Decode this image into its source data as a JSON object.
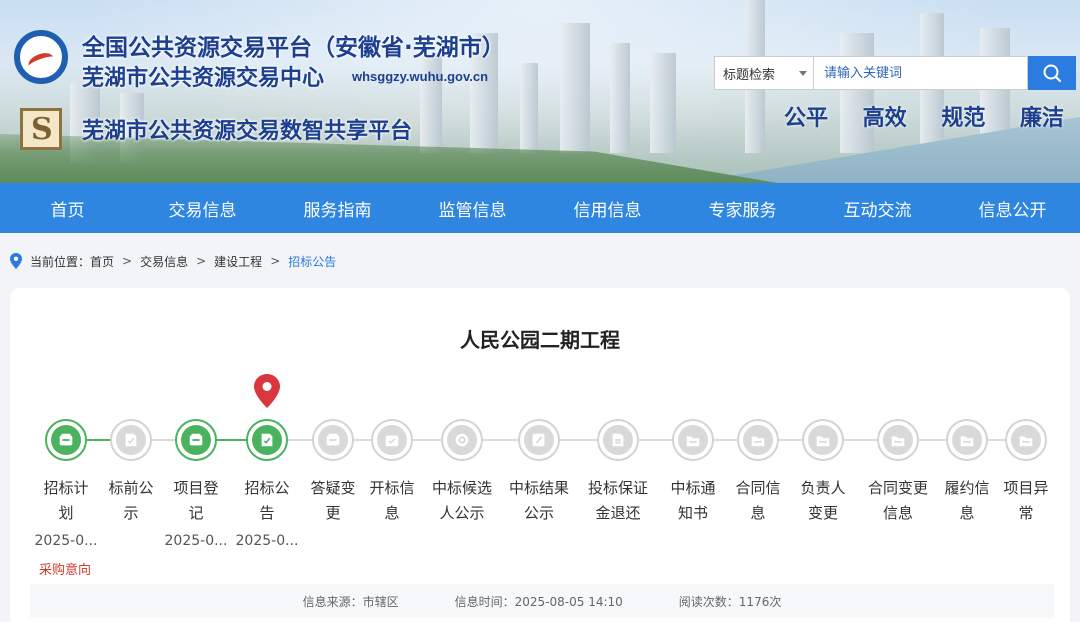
{
  "header": {
    "title_line1": "全国公共资源交易平台（安徽省·芜湖市）",
    "title_line2": "芜湖市公共资源交易中心",
    "domain": "whsggzy.wuhu.gov.cn",
    "title_line3": "芜湖市公共资源交易数智共享平台",
    "search": {
      "select_value": "标题检索",
      "placeholder": "请输入关键词"
    },
    "slogans": [
      "公平",
      "高效",
      "规范",
      "廉洁"
    ]
  },
  "nav": {
    "items": [
      "首页",
      "交易信息",
      "服务指南",
      "监管信息",
      "信用信息",
      "专家服务",
      "互动交流",
      "信息公开"
    ]
  },
  "breadcrumb": {
    "prefix": "当前位置：",
    "items": [
      "首页",
      "交易信息",
      "建设工程"
    ],
    "current": "招标公告",
    "separator": ">"
  },
  "main": {
    "title": "人民公园二期工程",
    "steps": [
      {
        "line1": "招标计",
        "line2": "划",
        "date": "2025-0...",
        "note": "采购意向",
        "status": "done",
        "icon": "box-icon"
      },
      {
        "line1": "标前公",
        "line2": "示",
        "date": "",
        "note": "",
        "status": "pending",
        "icon": "document-icon"
      },
      {
        "line1": "项目登",
        "line2": "记",
        "date": "2025-0...",
        "note": "",
        "status": "done",
        "icon": "box-icon"
      },
      {
        "line1": "招标公",
        "line2": "告",
        "date": "2025-0...",
        "note": "",
        "status": "done",
        "icon": "document-icon",
        "current": true
      },
      {
        "line1": "答疑变",
        "line2": "更",
        "date": "",
        "note": "",
        "status": "pending",
        "icon": "box-icon"
      },
      {
        "line1": "开标信",
        "line2": "息",
        "date": "",
        "note": "",
        "status": "pending",
        "icon": "calendar-icon"
      },
      {
        "line1": "中标候选",
        "line2": "人公示",
        "date": "",
        "note": "",
        "status": "pending",
        "icon": "target-icon"
      },
      {
        "line1": "中标结果",
        "line2": "公示",
        "date": "",
        "note": "",
        "status": "pending",
        "icon": "edit-icon"
      },
      {
        "line1": "投标保证",
        "line2": "金退还",
        "date": "",
        "note": "",
        "status": "pending",
        "icon": "return-icon"
      },
      {
        "line1": "中标通",
        "line2": "知书",
        "date": "",
        "note": "",
        "status": "pending",
        "icon": "folder-icon"
      },
      {
        "line1": "合同信",
        "line2": "息",
        "date": "",
        "note": "",
        "status": "pending",
        "icon": "folder-icon"
      },
      {
        "line1": "负责人",
        "line2": "变更",
        "date": "",
        "note": "",
        "status": "pending",
        "icon": "folder-icon"
      },
      {
        "line1": "合同变更",
        "line2": "信息",
        "date": "",
        "note": "",
        "status": "pending",
        "icon": "folder-icon"
      },
      {
        "line1": "履约信",
        "line2": "息",
        "date": "",
        "note": "",
        "status": "pending",
        "icon": "folder-icon"
      },
      {
        "line1": "项目异",
        "line2": "常",
        "date": "",
        "note": "",
        "status": "pending",
        "icon": "folder-icon"
      }
    ],
    "info": {
      "source": "信息来源：市辖区",
      "time": "信息时间：2025-08-05 14:10",
      "views": "阅读次数：1176次"
    }
  },
  "colors": {
    "nav_bg": "#2e86e0",
    "accent": "#2b7be0",
    "done_green": "#4bb35e",
    "pending_gray": "#d9d9d9",
    "pin_red": "#d9363e",
    "note_red": "#d23a2c"
  }
}
